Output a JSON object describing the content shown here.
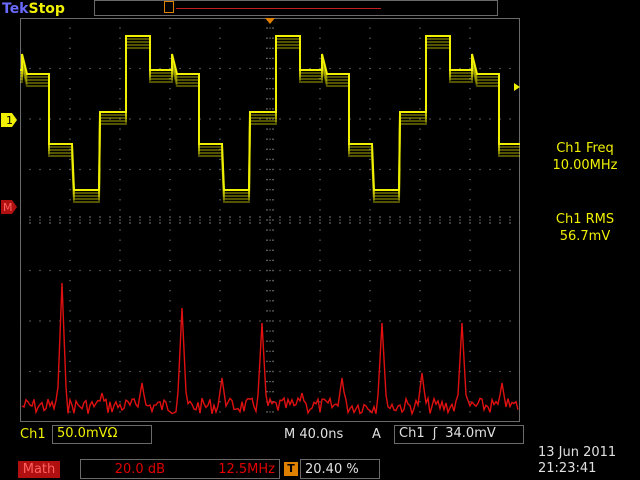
{
  "header": {
    "brand": "Tek",
    "run_state": "Stop"
  },
  "markers": {
    "ch1": "1",
    "math": "M"
  },
  "measurements": [
    {
      "label": "Ch1 Freq",
      "value": "10.00MHz"
    },
    {
      "label": "Ch1 RMS",
      "value": "56.7mV"
    }
  ],
  "channel": {
    "name": "Ch1",
    "scale": "50.0mVΩ"
  },
  "timebase": {
    "prefix": "M",
    "value": "40.0ns"
  },
  "trigger": {
    "mode": "A",
    "source": "Ch1",
    "slope_icon": "ʃ",
    "level": "34.0mV"
  },
  "math": {
    "label": "Math",
    "scale": "20.0 dB",
    "span": "12.5MHz"
  },
  "trigger_position": {
    "icon": "T",
    "value": "20.40 %"
  },
  "datetime": {
    "date": "13 Jun  2011",
    "time": "21:23:41"
  },
  "colors": {
    "ch1": "#f0f000",
    "math": "#e01010",
    "grid": "#6a6a6a",
    "trigger": "#e08000"
  }
}
